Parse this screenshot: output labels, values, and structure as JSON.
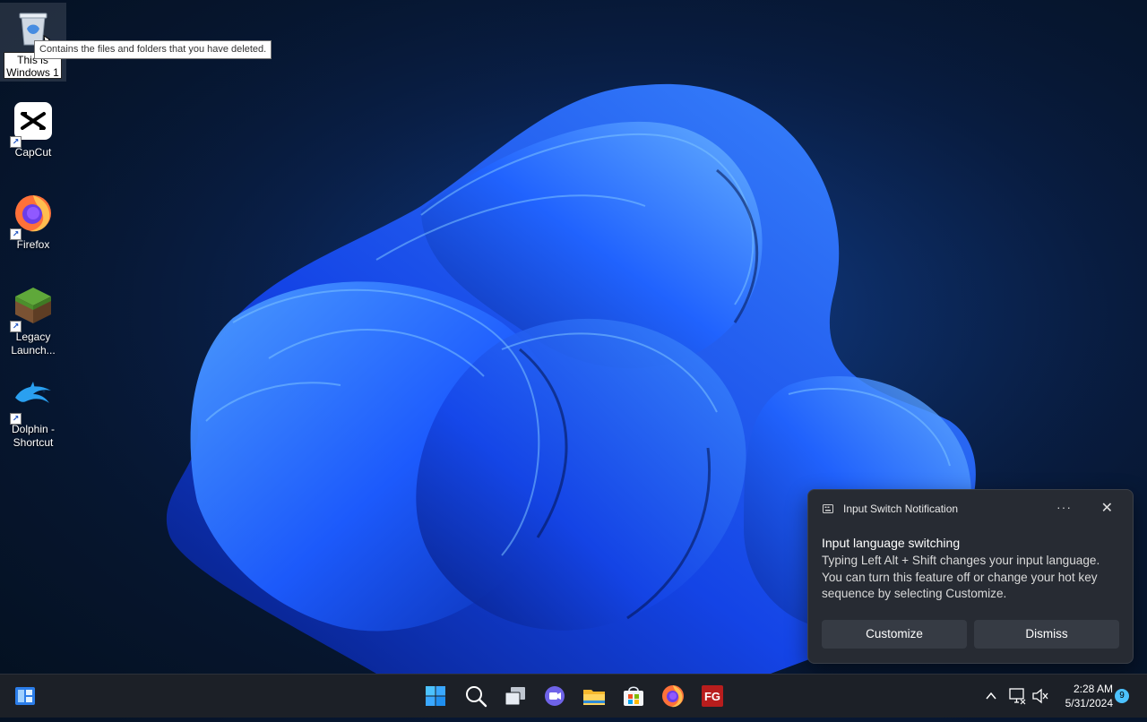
{
  "desktop": {
    "recycle_bin": {
      "rename_value": "This is Windows 1",
      "tooltip": "Contains the files and folders that you have deleted."
    },
    "icons": [
      {
        "label": "CapCut",
        "icon": "capcut-icon"
      },
      {
        "label": "Firefox",
        "icon": "firefox-icon"
      },
      {
        "label": "Legacy Launch...",
        "icon": "minecraft-grass-block-icon"
      },
      {
        "label": "Dolphin - Shortcut",
        "icon": "dolphin-icon"
      }
    ]
  },
  "notification": {
    "app_name": "Input Switch Notification",
    "more_label": "···",
    "close_label": "✕",
    "title": "Input language switching",
    "body": "Typing Left Alt + Shift changes your input language. You can turn this feature off or change your hot key sequence by selecting Customize.",
    "customize_label": "Customize",
    "dismiss_label": "Dismiss"
  },
  "taskbar": {
    "pinned": [
      "windows-start-icon",
      "search-icon",
      "task-view-icon",
      "teams-chat-icon",
      "file-explorer-icon",
      "microsoft-store-icon",
      "firefox-icon",
      "fg-app-icon"
    ],
    "fg_label": "FG",
    "tray": {
      "chevron": "^",
      "time": "2:28 AM",
      "date": "5/31/2024",
      "notification_count": "9"
    }
  },
  "colors": {
    "accent": "#4cc2ff",
    "taskbar_bg": "#1c2027",
    "toast_bg": "#272b33"
  }
}
